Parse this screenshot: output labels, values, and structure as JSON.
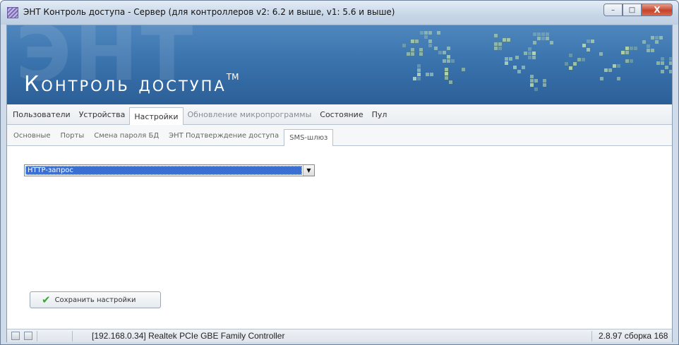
{
  "window": {
    "title": "ЭНТ Контроль доступа - Сервер (для контроллеров v2: 6.2  и выше, v1: 5.6 и выше)",
    "min_label": "–",
    "max_label": "□",
    "close_label": "X"
  },
  "banner": {
    "background_text": "ЭНТ",
    "title": "Контроль доступа",
    "tm": "TM"
  },
  "main_tabs": [
    {
      "label": "Пользователи",
      "state": "normal"
    },
    {
      "label": "Устройства",
      "state": "normal"
    },
    {
      "label": "Настройки",
      "state": "active"
    },
    {
      "label": "Обновление микропрограммы",
      "state": "dim"
    },
    {
      "label": "Состояние",
      "state": "normal"
    },
    {
      "label": "Пул",
      "state": "normal"
    }
  ],
  "sub_tabs": [
    {
      "label": "Основные",
      "state": "normal"
    },
    {
      "label": "Порты",
      "state": "normal"
    },
    {
      "label": "Смена пароля БД",
      "state": "normal"
    },
    {
      "label": "ЭНТ Подтверждение доступа",
      "state": "normal"
    },
    {
      "label": "SMS-шлюз",
      "state": "active"
    }
  ],
  "content": {
    "gateway_select_value": "HTTP-запрос",
    "save_button_label": "Сохранить настройки"
  },
  "statusbar": {
    "network_adapter": "[192.168.0.34] Realtek PCIe GBE Family Controller",
    "version": "2.8.97 сборка 168"
  },
  "colors": {
    "banner_blue": "#3a73ad",
    "selection_blue": "#3b6fd1",
    "check_green": "#3fa33a",
    "close_red": "#c6432a"
  },
  "icons": [
    "app-icon",
    "minimize-icon",
    "maximize-icon",
    "close-icon",
    "dropdown-arrow-icon",
    "checkmark-icon"
  ]
}
